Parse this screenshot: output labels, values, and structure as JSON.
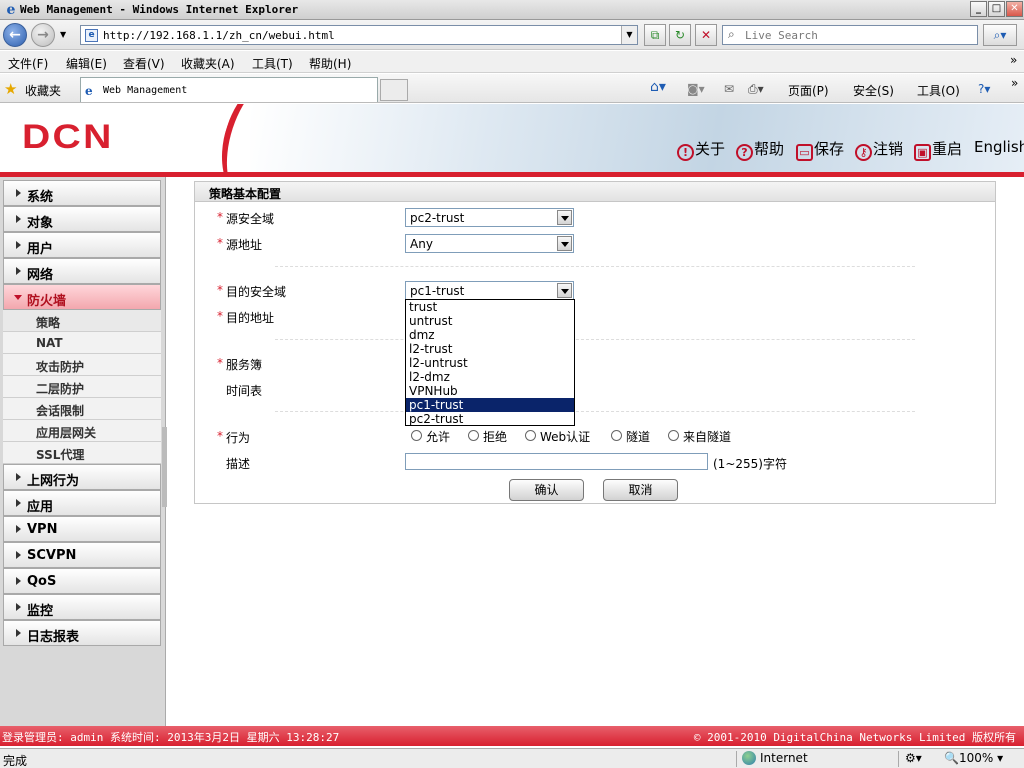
{
  "window": {
    "title": "Web Management - Windows Internet Explorer",
    "min": "_",
    "max": "□",
    "close": "✕"
  },
  "address": {
    "url": "http://192.168.1.1/zh_cn/webui.html",
    "search_placeholder": "Live Search"
  },
  "menubar": [
    "文件(F)",
    "编辑(E)",
    "查看(V)",
    "收藏夹(A)",
    "工具(T)",
    "帮助(H)"
  ],
  "favbar": {
    "favorites": "收藏夹",
    "tab_title": "Web Management",
    "commands": [
      "页面(P)",
      "安全(S)",
      "工具(O)"
    ]
  },
  "header": {
    "logo": "DCN",
    "links": [
      {
        "icon": "!",
        "label": "关于"
      },
      {
        "icon": "?",
        "label": "帮助"
      },
      {
        "icon": "▭",
        "label": "保存"
      },
      {
        "icon": "⚷",
        "label": "注销"
      },
      {
        "icon": "▣",
        "label": "重启"
      }
    ],
    "english": "English"
  },
  "sidebar": {
    "items_top": [
      "系统",
      "对象",
      "用户",
      "网络"
    ],
    "active": "防火墙",
    "subitems": [
      "策略",
      "NAT",
      "攻击防护",
      "二层防护",
      "会话限制",
      "应用层网关",
      "SSL代理"
    ],
    "items_bottom": [
      "上网行为",
      "应用",
      "VPN",
      "SCVPN",
      "QoS",
      "监控",
      "日志报表"
    ]
  },
  "form": {
    "title": "策略基本配置",
    "src_zone_label": "源安全域",
    "src_zone_value": "pc2-trust",
    "src_addr_label": "源地址",
    "src_addr_value": "Any",
    "dst_zone_label": "目的安全域",
    "dst_zone_value": "pc1-trust",
    "dst_addr_label": "目的地址",
    "service_label": "服务簿",
    "schedule_label": "时间表",
    "action_label": "行为",
    "actions": [
      "允许",
      "拒绝",
      "Web认证",
      "隧道",
      "来自隧道"
    ],
    "desc_label": "描述",
    "desc_hint": "(1~255)字符",
    "ok": "确认",
    "cancel": "取消",
    "required_mark": "*"
  },
  "dropdown": {
    "options": [
      "trust",
      "untrust",
      "dmz",
      "l2-trust",
      "l2-untrust",
      "l2-dmz",
      "VPNHub",
      "pc1-trust",
      "pc2-trust"
    ],
    "highlighted": "pc1-trust"
  },
  "footer": {
    "left": "登录管理员: admin 系统时间: 2013年3月2日 星期六 13:28:27",
    "right": "© 2001-2010 DigitalChina Networks Limited 版权所有"
  },
  "status": {
    "done": "完成",
    "zone": "Internet",
    "zoom": "100%"
  }
}
